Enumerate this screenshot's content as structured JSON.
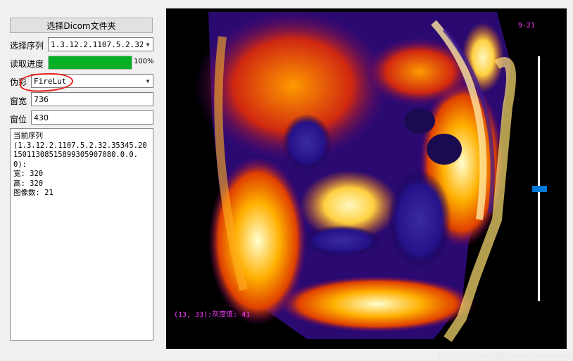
{
  "controls": {
    "select_folder_label": "选择Dicom文件夹",
    "series_label": "选择序列",
    "series_value": "1.3.12.2.1107.5.2.32.",
    "progress_label": "读取进度",
    "progress_value": 1.0,
    "progress_text": "100%",
    "pseudo_color_label": "伪彩",
    "pseudo_color_value": "FireLut",
    "window_width_label": "窗宽",
    "window_width_value": "736",
    "window_level_label": "窗位",
    "window_level_value": "430"
  },
  "info": {
    "text": "当前序列\n(1.3.12.2.1107.5.2.32.35345.2015011308515899305907080.0.0.0):\n宽: 320\n高: 320\n图像数: 21"
  },
  "viewer": {
    "slice_indicator": "9-21",
    "pixel_readout": "(13, 33):灰度值: 41",
    "slider_value": 0.54
  },
  "watermark": "https://blog.csdn.net/chaoenhu",
  "colors": {
    "progress_fill": "#06b025",
    "overlay_text": "#ff3cff",
    "slider_thumb": "#0078d7"
  },
  "icons": {
    "dropdown": "chevron-down-icon"
  }
}
